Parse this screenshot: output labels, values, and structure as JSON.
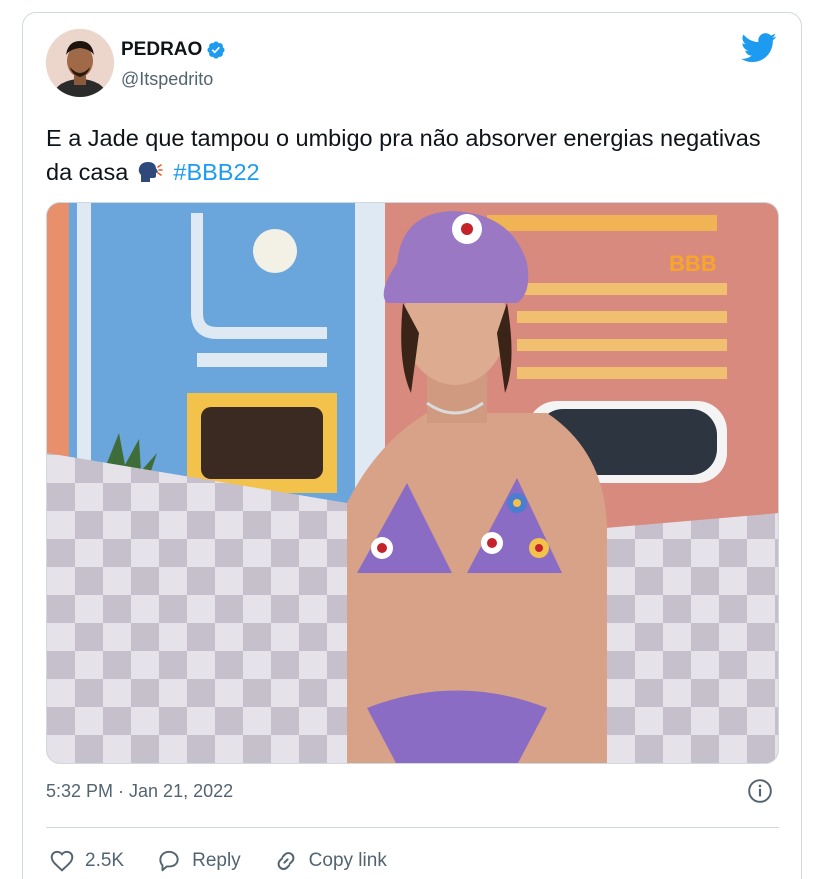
{
  "author": {
    "name": "PEDRAO",
    "handle": "@Itspedrito"
  },
  "tweet": {
    "text": "E a Jade que tampou o umbigo pra não absorver energias negativas da casa",
    "hashtag": "#BBB22",
    "emoji": "speaking-head-emoji",
    "media_watermark": "BBB",
    "timestamp": "5:32 PM · Jan 21, 2022"
  },
  "actions": {
    "likes": "2.5K",
    "reply": "Reply",
    "copy_link": "Copy link"
  },
  "colors": {
    "accent": "#1d9bf0",
    "text": "#0f1419",
    "secondary": "#536471",
    "border": "#cfd9de"
  },
  "icons": [
    "twitter-bird-icon",
    "verified-badge-icon",
    "info-icon",
    "heart-icon",
    "reply-icon",
    "link-icon"
  ]
}
